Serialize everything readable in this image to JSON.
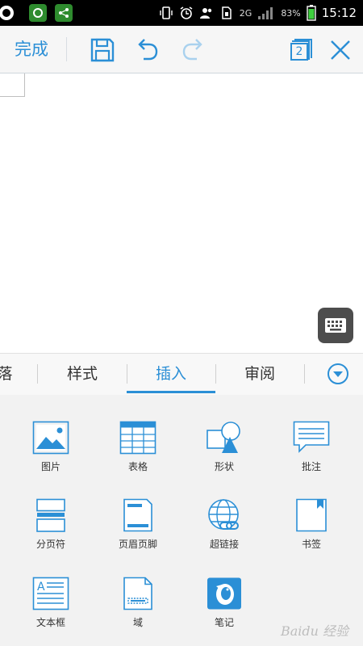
{
  "status_bar": {
    "network": "2G",
    "battery": "83%",
    "time": "15:12"
  },
  "toolbar": {
    "done_label": "完成",
    "page_count": "2"
  },
  "tabs": [
    {
      "label": "落"
    },
    {
      "label": "样式"
    },
    {
      "label": "插入"
    },
    {
      "label": "审阅"
    }
  ],
  "insert_items": [
    {
      "label": "图片",
      "icon": "picture-icon"
    },
    {
      "label": "表格",
      "icon": "table-icon"
    },
    {
      "label": "形状",
      "icon": "shape-icon"
    },
    {
      "label": "批注",
      "icon": "comment-icon"
    },
    {
      "label": "分页符",
      "icon": "page-break-icon"
    },
    {
      "label": "页眉页脚",
      "icon": "header-footer-icon"
    },
    {
      "label": "超链接",
      "icon": "hyperlink-icon"
    },
    {
      "label": "书签",
      "icon": "bookmark-icon"
    },
    {
      "label": "文本框",
      "icon": "text-box-icon"
    },
    {
      "label": "域",
      "icon": "field-icon"
    },
    {
      "label": "笔记",
      "icon": "note-icon"
    }
  ],
  "watermark": "Baidu 经验",
  "colors": {
    "accent": "#2b8fd6",
    "toolbar_bg": "#f6f6f6",
    "panel_bg": "#f2f2f2"
  }
}
